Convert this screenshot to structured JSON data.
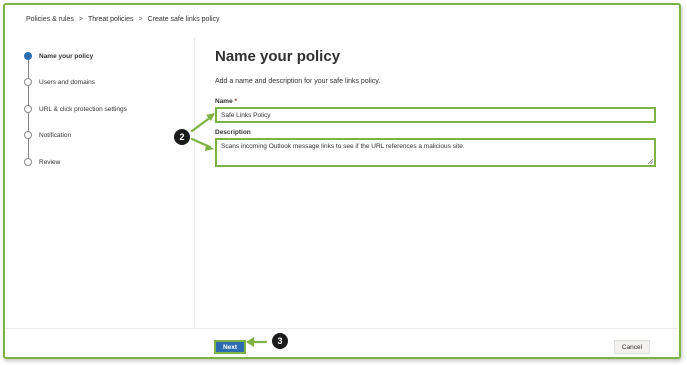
{
  "breadcrumb": {
    "items": [
      "Policies & rules",
      "Threat policies",
      "Create safe links policy"
    ],
    "separator": ">"
  },
  "steps": [
    {
      "label": "Name your policy",
      "active": true
    },
    {
      "label": "Users and domains",
      "active": false
    },
    {
      "label": "URL & click protection settings",
      "active": false
    },
    {
      "label": "Notification",
      "active": false
    },
    {
      "label": "Review",
      "active": false
    }
  ],
  "main": {
    "title": "Name your policy",
    "subtitle": "Add a name and description for your safe links policy.",
    "name_label": "Name",
    "required_marker": "*",
    "name_value": "Safe Links Policy",
    "description_label": "Description",
    "description_value": "Scans incoming Outlook message links to see if the URL references a malicious site."
  },
  "footer": {
    "next_label": "Next",
    "cancel_label": "Cancel"
  },
  "callouts": {
    "fields_number": "2",
    "next_number": "3"
  },
  "colors": {
    "highlight": "#7cb342",
    "primary": "#2b6cb3",
    "callout_bg": "#1b1b1b"
  }
}
